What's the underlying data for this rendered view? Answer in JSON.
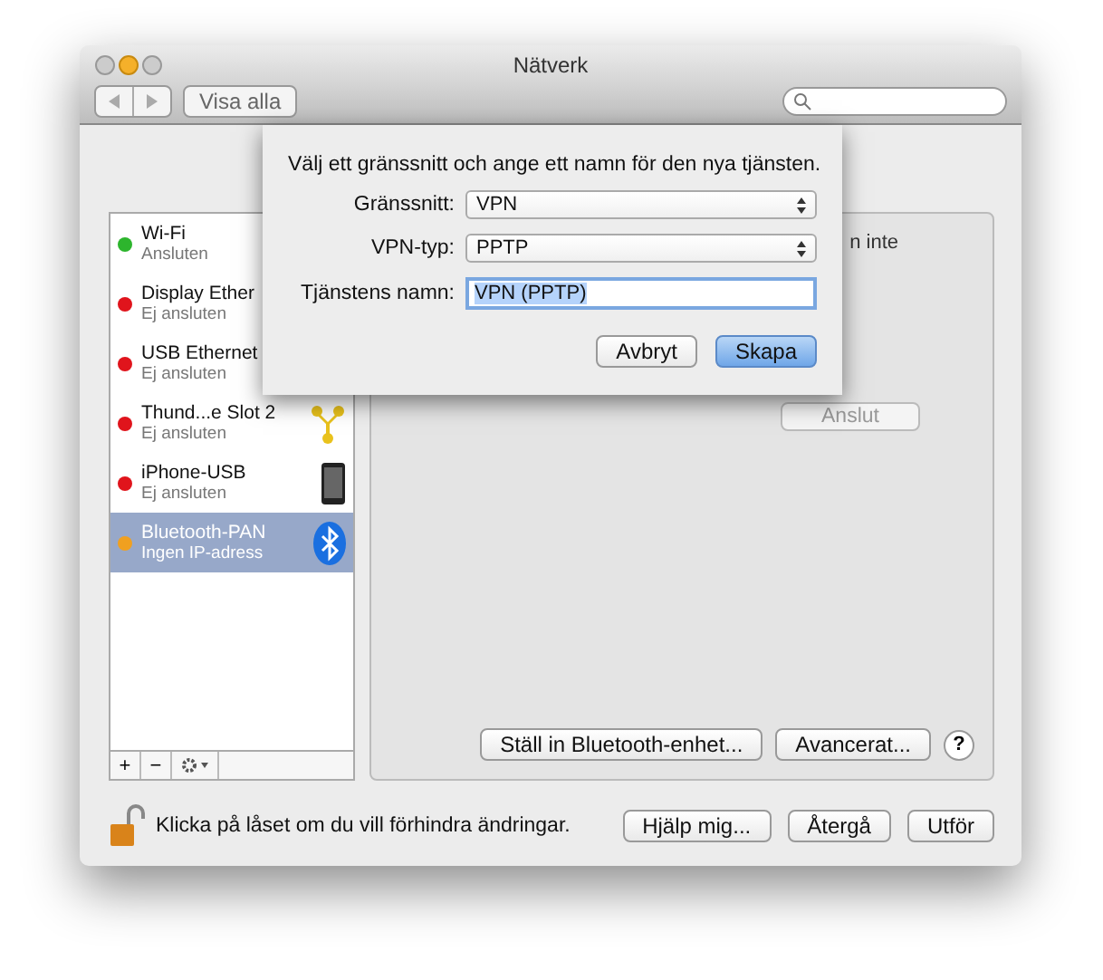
{
  "window": {
    "title": "Nätverk"
  },
  "toolbar": {
    "show_all": "Visa alla"
  },
  "sidebar": {
    "items": [
      {
        "name": "Wi-Fi",
        "status": "Ansluten",
        "color": "#2db52d",
        "kind": "wifi",
        "selected": false
      },
      {
        "name": "Display Ether",
        "status": "Ej ansluten",
        "color": "#e0141c",
        "kind": "display",
        "selected": false
      },
      {
        "name": "USB Ethernet",
        "status": "Ej ansluten",
        "color": "#e0141c",
        "kind": "ethernet",
        "selected": false
      },
      {
        "name": "Thund...e Slot 2",
        "status": "Ej ansluten",
        "color": "#e0141c",
        "kind": "thunderbolt",
        "selected": false
      },
      {
        "name": "iPhone-USB",
        "status": "Ej ansluten",
        "color": "#e0141c",
        "kind": "iphone",
        "selected": false
      },
      {
        "name": "Bluetooth-PAN",
        "status": "Ingen IP-adress",
        "color": "#f0a020",
        "kind": "bluetooth",
        "selected": true
      }
    ],
    "buttons": [
      "+",
      "−"
    ]
  },
  "panel": {
    "partial_text": "n inte",
    "connect": {
      "label": "Anslut",
      "disabled": true
    },
    "setup": "Ställ in Bluetooth-enhet...",
    "advanced": "Avancerat...",
    "help": "?"
  },
  "footer": {
    "lock_text": "Klicka på låset om du vill förhindra ändringar.",
    "buttons": [
      {
        "label": "Hjälp mig...",
        "default": false
      },
      {
        "label": "Återgå",
        "default": false
      },
      {
        "label": "Utför",
        "default": false
      }
    ]
  },
  "sheet": {
    "message": "Välj ett gränssnitt och ange ett namn för den nya tjänsten.",
    "fields": [
      {
        "kind": "select",
        "label": "Gränssnitt:",
        "value": "VPN"
      },
      {
        "kind": "select",
        "label": "VPN-typ:",
        "value": "PPTP"
      },
      {
        "kind": "text",
        "label": "Tjänstens namn:",
        "value": "VPN (PPTP)"
      }
    ],
    "buttons": [
      {
        "label": "Avbryt",
        "default": false
      },
      {
        "label": "Skapa",
        "default": true
      }
    ]
  }
}
